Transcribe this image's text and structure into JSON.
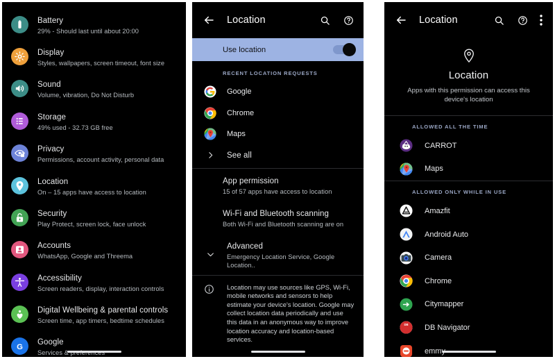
{
  "panel1": {
    "name": "android-settings-list",
    "items": [
      {
        "title": "Battery",
        "sub": "29% - Should last until about 20:00",
        "icon": "battery-icon",
        "color": "#3c8d87"
      },
      {
        "title": "Display",
        "sub": "Styles, wallpapers, screen timeout, font size",
        "icon": "brightness-icon",
        "color": "#efa03b"
      },
      {
        "title": "Sound",
        "sub": "Volume, vibration, Do Not Disturb",
        "icon": "volume-icon",
        "color": "#3c8d87"
      },
      {
        "title": "Storage",
        "sub": "49% used - 32.73 GB free",
        "icon": "storage-list-icon",
        "color": "#b05cd9"
      },
      {
        "title": "Privacy",
        "sub": "Permissions, account activity, personal data",
        "icon": "privacy-eye-icon",
        "color": "#6d83d8"
      },
      {
        "title": "Location",
        "sub": "On – 15 apps have access to location",
        "icon": "location-pin-icon",
        "color": "#5cc3dd"
      },
      {
        "title": "Security",
        "sub": "Play Protect, screen lock, face unlock",
        "icon": "security-lock-icon",
        "color": "#42a354"
      },
      {
        "title": "Accounts",
        "sub": "WhatsApp, Google and Threema",
        "icon": "accounts-person-icon",
        "color": "#e1577e"
      },
      {
        "title": "Accessibility",
        "sub": "Screen readers, display, interaction controls",
        "icon": "accessibility-icon",
        "color": "#7a3fe0"
      },
      {
        "title": "Digital Wellbeing & parental controls",
        "sub": "Screen time, app timers, bedtime schedules",
        "icon": "wellbeing-heart-icon",
        "color": "#5bc154"
      },
      {
        "title": "Google",
        "sub": "Services & preferences",
        "icon": "google-g-icon",
        "color": "#1a73e8"
      }
    ]
  },
  "panel2": {
    "appbar": {
      "title": "Location",
      "back": "back-arrow-icon",
      "search": "search-icon",
      "help": "help-icon"
    },
    "use_location": {
      "label": "Use location",
      "state": "on",
      "highlight_color": "#9db3e3"
    },
    "recent_section_label": "Recent location requests",
    "recent_apps": [
      {
        "name": "Google",
        "icon": "google-g-icon"
      },
      {
        "name": "Chrome",
        "icon": "chrome-icon"
      },
      {
        "name": "Maps",
        "icon": "google-maps-icon"
      }
    ],
    "see_all": "See all",
    "settings": [
      {
        "title": "App permission",
        "sub": "15 of 57 apps have access to location",
        "chevron": false
      },
      {
        "title": "Wi-Fi and Bluetooth scanning",
        "sub": "Both Wi-Fi and Bluetooth scanning are on",
        "chevron": false
      },
      {
        "title": "Advanced",
        "sub": "Emergency Location Service, Google Location..",
        "chevron": true
      }
    ],
    "footer_note": "Location may use sources like GPS, Wi-Fi, mobile networks and sensors to help estimate your device's location. Google may collect location data periodically and use this data in an anonymous way to improve location accuracy and location-based services."
  },
  "panel3": {
    "appbar": {
      "title": "Location",
      "back": "back-arrow-icon",
      "search": "search-icon",
      "help": "help-icon",
      "more": "more-vertical-icon"
    },
    "hero": {
      "icon": "location-pin-icon",
      "title": "Location",
      "subtitle": "Apps with this permission can access this device's location"
    },
    "groups": [
      {
        "label": "Allowed all the time",
        "apps": [
          {
            "name": "CARROT",
            "icon": "carrot-weather-icon"
          },
          {
            "name": "Maps",
            "icon": "google-maps-icon"
          }
        ]
      },
      {
        "label": "Allowed only while in use",
        "apps": [
          {
            "name": "Amazfit",
            "icon": "amazfit-icon"
          },
          {
            "name": "Android Auto",
            "icon": "android-auto-icon"
          },
          {
            "name": "Camera",
            "icon": "camera-icon"
          },
          {
            "name": "Chrome",
            "icon": "chrome-icon"
          },
          {
            "name": "Citymapper",
            "icon": "citymapper-icon"
          },
          {
            "name": "DB Navigator",
            "icon": "db-navigator-icon"
          },
          {
            "name": "emmy",
            "icon": "emmy-icon"
          }
        ]
      }
    ]
  }
}
